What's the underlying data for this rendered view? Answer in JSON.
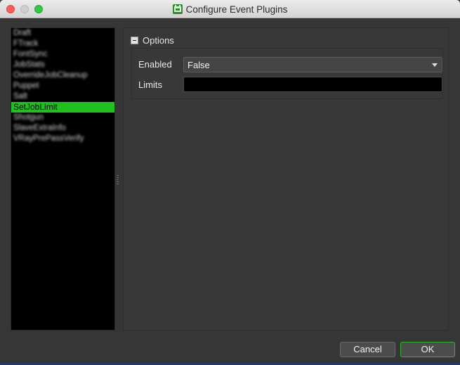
{
  "window": {
    "title": "Configure Event Plugins",
    "icon": "deadline-monitor-icon"
  },
  "plugins": {
    "items": [
      {
        "label": "Draft",
        "selected": false,
        "blurred": true
      },
      {
        "label": "FTrack",
        "selected": false,
        "blurred": true
      },
      {
        "label": "FontSync",
        "selected": false,
        "blurred": true
      },
      {
        "label": "JobStats",
        "selected": false,
        "blurred": true
      },
      {
        "label": "OverrideJobCleanup",
        "selected": false,
        "blurred": true
      },
      {
        "label": "Puppet",
        "selected": false,
        "blurred": true
      },
      {
        "label": "Salt",
        "selected": false,
        "blurred": true
      },
      {
        "label": "SetJobLimit",
        "selected": true,
        "blurred": false
      },
      {
        "label": "Shotgun",
        "selected": false,
        "blurred": true
      },
      {
        "label": "SlaveExtraInfo",
        "selected": false,
        "blurred": true
      },
      {
        "label": "VRayPrePassVerify",
        "selected": false,
        "blurred": true
      }
    ]
  },
  "options": {
    "group_title": "Options",
    "enabled_label": "Enabled",
    "enabled_value": "False",
    "limits_label": "Limits",
    "limits_value": ""
  },
  "buttons": {
    "cancel_label": "Cancel",
    "ok_label": "OK"
  },
  "colors": {
    "selection": "#1fc11f",
    "ok_border": "#2fb52f"
  }
}
